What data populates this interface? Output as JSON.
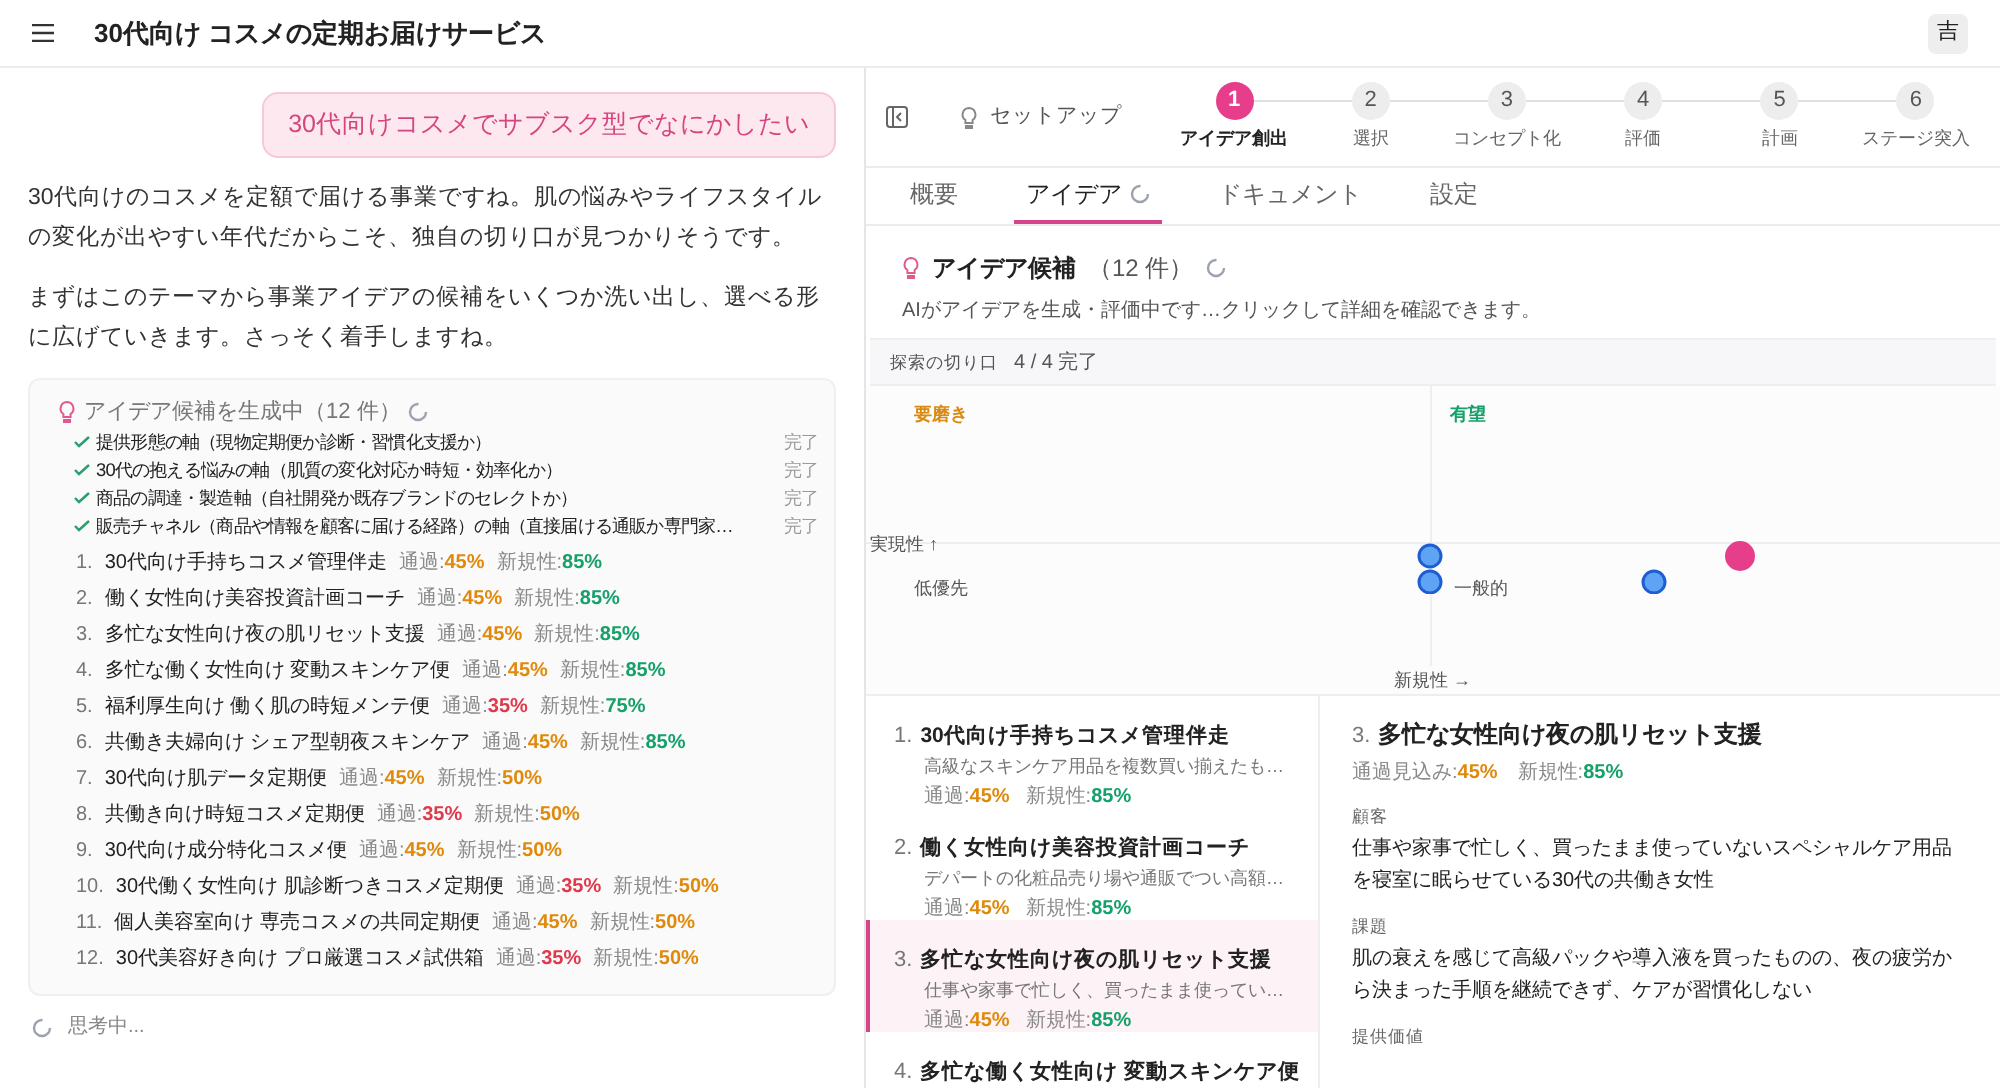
{
  "header": {
    "title": "30代向け コスメの定期お届けサービス",
    "avatar": "吉"
  },
  "chat": {
    "user_message": "30代向けコスメでサブスク型でなにかしたい",
    "paragraphs": [
      "30代向けのコスメを定額で届ける事業ですね。肌の悩みやライフスタイルの変化が出やすい年代だからこそ、独自の切り口が見つかりそうです。",
      "まずはこのテーマから事業アイデアの候補をいくつか洗い出し、選べる形に広げていきます。さっそく着手しますね。"
    ],
    "card": {
      "title": "アイデア候補を生成中（12 件）",
      "axes": [
        {
          "text": "提供形態の軸（現物定期便か診断・習慣化支援か）",
          "status": "完了",
          "checked": true
        },
        {
          "text": "30代の抱える悩みの軸（肌質の変化対応か時短・効率化か）",
          "status": "完了",
          "checked": true
        },
        {
          "text": "商品の調達・製造軸（自社開発か既存ブランドのセレクトか）",
          "status": "完了",
          "checked": true
        },
        {
          "text": "販売チャネル（商品や情報を顧客に届ける経路）の軸（直接届ける通販か専門家…",
          "status": "完了",
          "checked": true
        }
      ],
      "ideas": [
        {
          "number": "1.",
          "title": "30代向け手持ちコスメ管理伴走",
          "pass": {
            "label": "通過:",
            "value": "45%",
            "color": "#e08a0c"
          },
          "novelty": {
            "label": "新規性:",
            "value": "85%",
            "color": "#16a06a"
          }
        },
        {
          "number": "2.",
          "title": "働く女性向け美容投資計画コーチ",
          "pass": {
            "label": "通過:",
            "value": "45%",
            "color": "#e08a0c"
          },
          "novelty": {
            "label": "新規性:",
            "value": "85%",
            "color": "#16a06a"
          }
        },
        {
          "number": "3.",
          "title": "多忙な女性向け夜の肌リセット支援",
          "pass": {
            "label": "通過:",
            "value": "45%",
            "color": "#e08a0c"
          },
          "novelty": {
            "label": "新規性:",
            "value": "85%",
            "color": "#16a06a"
          }
        },
        {
          "number": "4.",
          "title": "多忙な働く女性向け 変動スキンケア便",
          "pass": {
            "label": "通過:",
            "value": "45%",
            "color": "#e08a0c"
          },
          "novelty": {
            "label": "新規性:",
            "value": "85%",
            "color": "#16a06a"
          }
        },
        {
          "number": "5.",
          "title": "福利厚生向け 働く肌の時短メンテ便",
          "pass": {
            "label": "通過:",
            "value": "35%",
            "color": "#e0394b"
          },
          "novelty": {
            "label": "新規性:",
            "value": "75%",
            "color": "#16a06a"
          }
        },
        {
          "number": "6.",
          "title": "共働き夫婦向け シェア型朝夜スキンケア",
          "pass": {
            "label": "通過:",
            "value": "45%",
            "color": "#e08a0c"
          },
          "novelty": {
            "label": "新規性:",
            "value": "85%",
            "color": "#16a06a"
          }
        },
        {
          "number": "7.",
          "title": "30代向け肌データ定期便",
          "pass": {
            "label": "通過:",
            "value": "45%",
            "color": "#e08a0c"
          },
          "novelty": {
            "label": "新規性:",
            "value": "50%",
            "color": "#e08a0c"
          }
        },
        {
          "number": "8.",
          "title": "共働き向け時短コスメ定期便",
          "pass": {
            "label": "通過:",
            "value": "35%",
            "color": "#e0394b"
          },
          "novelty": {
            "label": "新規性:",
            "value": "50%",
            "color": "#e08a0c"
          }
        },
        {
          "number": "9.",
          "title": "30代向け成分特化コスメ便",
          "pass": {
            "label": "通過:",
            "value": "45%",
            "color": "#e08a0c"
          },
          "novelty": {
            "label": "新規性:",
            "value": "50%",
            "color": "#e08a0c"
          }
        },
        {
          "number": "10.",
          "title": "30代働く女性向け 肌診断つきコスメ定期便",
          "pass": {
            "label": "通過:",
            "value": "35%",
            "color": "#e0394b"
          },
          "novelty": {
            "label": "新規性:",
            "value": "50%",
            "color": "#e08a0c"
          }
        },
        {
          "number": "11.",
          "title": "個人美容室向け 専売コスメの共同定期便",
          "pass": {
            "label": "通過:",
            "value": "45%",
            "color": "#e08a0c"
          },
          "novelty": {
            "label": "新規性:",
            "value": "50%",
            "color": "#e08a0c"
          }
        },
        {
          "number": "12.",
          "title": "30代美容好き向け プロ厳選コスメ試供箱",
          "pass": {
            "label": "通過:",
            "value": "35%",
            "color": "#e0394b"
          },
          "novelty": {
            "label": "新規性:",
            "value": "50%",
            "color": "#e08a0c"
          }
        }
      ]
    },
    "thinking": "思考中..."
  },
  "stepper": {
    "setup": "セットアップ",
    "steps": [
      {
        "number": "1",
        "label": "アイデア創出",
        "selected": true
      },
      {
        "number": "2",
        "label": "選択",
        "selected": false
      },
      {
        "number": "3",
        "label": "コンセプト化",
        "selected": false
      },
      {
        "number": "4",
        "label": "評価",
        "selected": false
      },
      {
        "number": "5",
        "label": "計画",
        "selected": false
      },
      {
        "number": "6",
        "label": "ステージ突入",
        "selected": false
      }
    ]
  },
  "tabs": [
    {
      "label": "概要",
      "selected": false,
      "loading": false
    },
    {
      "label": "アイデア",
      "selected": true,
      "loading": true
    },
    {
      "label": "ドキュメント",
      "selected": false,
      "loading": false
    },
    {
      "label": "設定",
      "selected": false,
      "loading": false
    }
  ],
  "ideas_panel": {
    "title": "アイデア候補",
    "count": "（12 件）",
    "description": "AIがアイデアを生成・評価中です…クリックして詳細を確認できます。",
    "progress_label": "探索の切り口",
    "progress_value": "4 / 4 完了",
    "matrix": {
      "top_left": "要磨き",
      "top_right": "有望",
      "bottom_left": "低優先",
      "bottom_right": "一般的",
      "y_axis": "実現性 ↑",
      "x_axis": "新規性 →"
    },
    "list": [
      {
        "number": "1.",
        "title": "30代向け手持ちコスメ管理伴走",
        "summary": "高級なスキンケア用品を複数買い揃えたも…",
        "pass": {
          "label": "通過:",
          "value": "45%",
          "color": "#e08a0c"
        },
        "novelty": {
          "label": "新規性:",
          "value": "85%",
          "color": "#16a06a"
        },
        "selected": false
      },
      {
        "number": "2.",
        "title": "働く女性向け美容投資計画コーチ",
        "summary": "デパートの化粧品売り場や通販でつい高額…",
        "pass": {
          "label": "通過:",
          "value": "45%",
          "color": "#e08a0c"
        },
        "novelty": {
          "label": "新規性:",
          "value": "85%",
          "color": "#16a06a"
        },
        "selected": false
      },
      {
        "number": "3.",
        "title": "多忙な女性向け夜の肌リセット支援",
        "summary": "仕事や家事で忙しく、買ったまま使ってい…",
        "pass": {
          "label": "通過:",
          "value": "45%",
          "color": "#e08a0c"
        },
        "novelty": {
          "label": "新規性:",
          "value": "85%",
          "color": "#16a06a"
        },
        "selected": true
      },
      {
        "number": "4.",
        "title": "多忙な働く女性向け 変動スキンケア便",
        "selected": false
      }
    ],
    "detail": {
      "number": "3.",
      "title": "多忙な女性向け夜の肌リセット支援",
      "pass": {
        "label": "通過見込み:",
        "value": "45%",
        "color": "#e08a0c"
      },
      "novelty": {
        "label": "新規性:",
        "value": "85%",
        "color": "#16a06a"
      },
      "sections": [
        {
          "label": "顧客",
          "text": "仕事や家事で忙しく、買ったまま使っていないスペシャルケア用品を寝室に眠らせている30代の共働き女性"
        },
        {
          "label": "課題",
          "text": "肌の衰えを感じて高級パックや導入液を買ったものの、夜の疲労から決まった手順を継続できず、ケアが習慣化しない"
        },
        {
          "label": "提供価値"
        }
      ]
    }
  }
}
